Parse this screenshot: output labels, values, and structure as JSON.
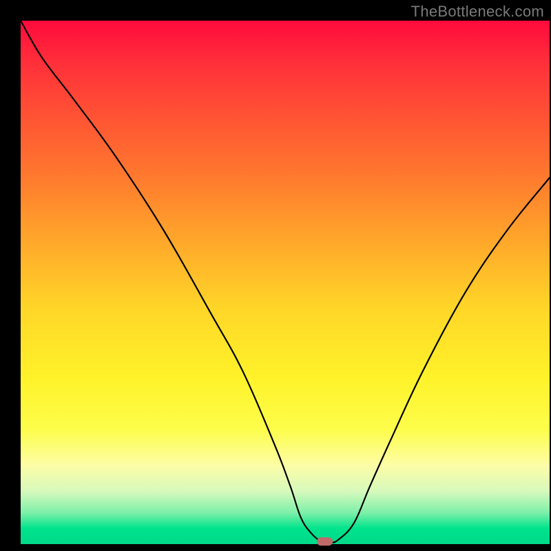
{
  "watermark": "TheBottleneck.com",
  "chart_data": {
    "type": "line",
    "title": "",
    "xlabel": "",
    "ylabel": "",
    "xlim": [
      0,
      100
    ],
    "ylim": [
      0,
      100
    ],
    "grid": false,
    "series": [
      {
        "name": "curve",
        "x": [
          0,
          4,
          10,
          18,
          27,
          36,
          42,
          48,
          51,
          53,
          55,
          57,
          58.5,
          60,
          63,
          66,
          70,
          76,
          84,
          92,
          100
        ],
        "y": [
          100,
          93,
          85,
          74,
          60,
          44,
          33,
          19,
          11,
          5,
          2,
          0.4,
          0.3,
          0.8,
          4,
          11,
          20,
          33,
          48,
          60,
          70
        ]
      }
    ],
    "marker": {
      "name": "bottleneck-point",
      "color": "#c06a6a",
      "x": 57.5,
      "y": 0.5,
      "shape": "rounded-rect",
      "w": 3,
      "h": 1.6
    }
  }
}
